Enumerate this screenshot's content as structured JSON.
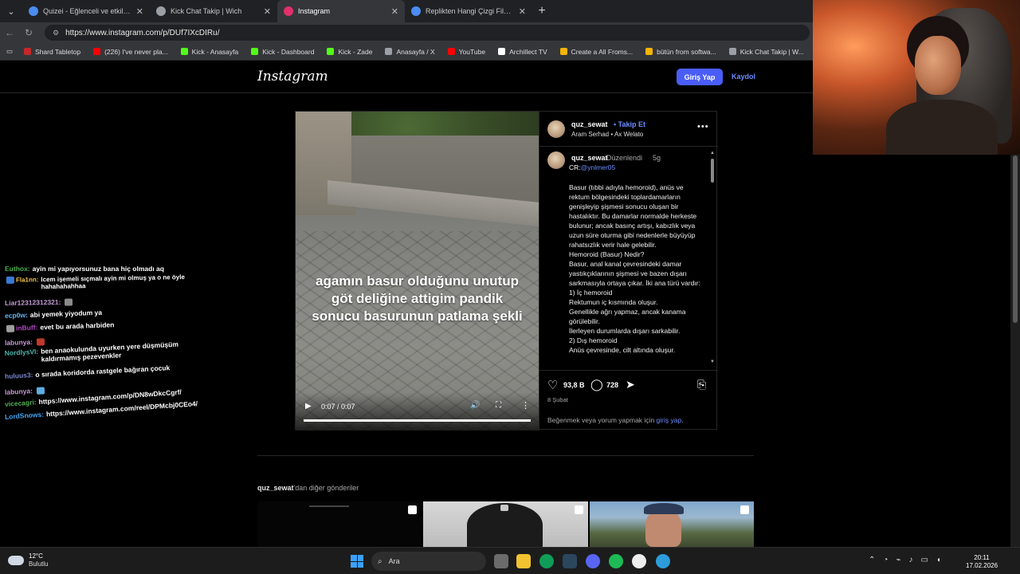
{
  "browser": {
    "tabs": [
      {
        "label": "Quizei - Eğlenceli ve etkileşimli qu",
        "active": false,
        "color": "#4b8cf0"
      },
      {
        "label": "Kick Chat Takip | Wich",
        "active": false,
        "color": "#9aa0a6"
      },
      {
        "label": "Instagram",
        "active": true,
        "color": "#e1306c"
      },
      {
        "label": "Replikten Hangi Çizgi Film Olduğu",
        "active": false,
        "color": "#4b8cf0"
      }
    ],
    "url": "https://www.instagram.com/p/DUf7IXcDIRu/",
    "bookmarks": [
      {
        "label": "Shard Tabletop",
        "color": "#c62828"
      },
      {
        "label": "(226) I've never pla...",
        "color": "#ff0000"
      },
      {
        "label": "Kick - Anasayfa",
        "color": "#53fc18"
      },
      {
        "label": "Kick - Dashboard",
        "color": "#53fc18"
      },
      {
        "label": "Kick - Zade",
        "color": "#53fc18"
      },
      {
        "label": "Anasayfa / X",
        "color": "#9aa0a6"
      },
      {
        "label": "YouTube",
        "color": "#ff0000"
      },
      {
        "label": "Archillect TV",
        "color": "#ffffff"
      },
      {
        "label": "Create a All Froms...",
        "color": "#f4b400"
      },
      {
        "label": "bütün from softwa...",
        "color": "#f4b400"
      },
      {
        "label": "Kick Chat Takip | W...",
        "color": "#9aa0a6"
      }
    ]
  },
  "instagram": {
    "logo": "Instagram",
    "login_label": "Giriş Yap",
    "signup_label": "Kaydol",
    "post": {
      "caption_overlay": "agamın basur olduğunu unutup göt deliğine attigim pandik sonucu basurunun patlama şekli",
      "video_time": "0:07 / 0:07",
      "progress_fraction": 1.0,
      "username": "quz_sewat",
      "follow_label": "Takip Et",
      "audio": "Aram Serhad • Ax Welato",
      "comment": {
        "username": "quz_sewat",
        "edited": "Düzenlendi",
        "time": "5g",
        "credit_prefix": "CR:",
        "credit_mention": "@ynlmer05",
        "body": "Basur (tıbbi adıyla hemoroid), anüs ve rektum bölgesindeki toplardamarların genişleyip şişmesi sonucu oluşan bir hastalıktır. Bu damarlar normalde herkeste bulunur; ancak basınç artışı, kabızlık veya uzun süre oturma gibi nedenlerle büyüyüp rahatsızlık verir hale gelebilir.\nHemoroid (Basur) Nedir?\n Basur, anal kanal çevresindeki damar yastıkçıklarının şişmesi ve bazen dışarı sarkmasıyla ortaya çıkar. İki ana türü vardır:\n1) İç hemoroid\nRektumun iç kısmında oluşur.\nGenellikle ağrı yapmaz, ancak kanama görülebilir.\nİlerleyen durumlarda dışarı sarkabilir.\n2) Dış hemoroid\nAnüs çevresinde, cilt altında oluşur."
      },
      "likes": "93,8 B",
      "comments_count": "728",
      "date": "8 Şubat",
      "login_prompt_prefix": "Beğenmek veya yorum yapmak için ",
      "login_prompt_link": "giriş yap",
      "login_prompt_suffix": "."
    },
    "more_posts_user": "quz_sewat",
    "more_posts_suffix": "'dan diğer gönderiler"
  },
  "chat": [
    {
      "user": "Euthox:",
      "color": "#4caf50",
      "msg": "ayin mi yapıyorsunuz bana hiç olmadı aq"
    },
    {
      "user": "Fla1nn:",
      "color": "#f0c040",
      "msg": "lcem işemeli sıçmalı ayin mi olmuş ya o ne öyle hahahahahhaa"
    },
    {
      "user": "Liar12312312321:",
      "color": "#c39bd3",
      "msg": ""
    },
    {
      "user": "ecp0w:",
      "color": "#64b5f6",
      "msg": "abi yemek yiyodum ya"
    },
    {
      "user": "inBuff:",
      "color": "#ab47bc",
      "msg": "evet bu arada harbiden"
    },
    {
      "user": "labunya:",
      "color": "#c39bd3",
      "msg": ""
    },
    {
      "user": "NordlysVI:",
      "color": "#4db6ac",
      "msg": "ben anaokulunda uyurken yere düşmüşüm kaldırmamış pezevenkler"
    },
    {
      "user": "huluus3:",
      "color": "#7986cb",
      "msg": "o sırada koridorda rastgele bağıran çocuk"
    },
    {
      "user": "labunya:",
      "color": "#c39bd3",
      "msg": ""
    },
    {
      "user": "vicecagri:",
      "color": "#4caf50",
      "msg": "https://www.instagram.com/p/DN8wDkcCgrf/"
    },
    {
      "user": "LordSnows:",
      "color": "#42a5f5",
      "msg": "https://www.instagram.com/reel/DPMcbj0CEo4/"
    }
  ],
  "taskbar": {
    "temp": "12°C",
    "weather": "Bulutlu",
    "search": "Ara",
    "time": "20:11",
    "date": "17.02.2026"
  }
}
